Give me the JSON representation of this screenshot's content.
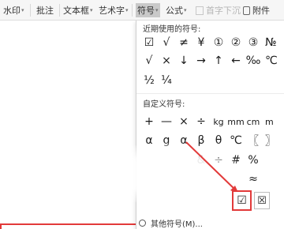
{
  "ribbon": {
    "watermark": "水印",
    "annotate": "批注",
    "textbox": "文本框",
    "wordart": "艺术字",
    "symbol": "符号",
    "formula": "公式",
    "dropcap": "首字下沉",
    "attachment": "附件"
  },
  "panel": {
    "recent_title": "近期使用的符号:",
    "recent_rows": [
      [
        "☑",
        "√",
        "≠",
        "¥",
        "①",
        "②",
        "③",
        "№"
      ],
      [
        "√",
        "×",
        "↓",
        "→",
        "↑",
        "←",
        "‰",
        "℃"
      ],
      [
        "½",
        "¼"
      ]
    ],
    "custom_title": "自定义符号:",
    "custom_rows": [
      [
        "+",
        "—",
        "×",
        "÷",
        "kg",
        "mm",
        "cm",
        "m"
      ],
      [
        "α",
        "g",
        "α",
        "β",
        "θ",
        "℃",
        "〖",
        "〗"
      ],
      [
        "",
        "",
        "",
        "&",
        "÷",
        "#",
        "%",
        ""
      ],
      [
        "",
        "",
        "",
        "",
        "",
        "",
        "≈",
        ""
      ]
    ],
    "highlighted_symbol": "☑",
    "next_symbol": "☒",
    "more_symbols": "其他符号(M)..."
  },
  "colors": {
    "highlight_red": "#e23a3a",
    "ribbon_bg": "#f6f6f6"
  }
}
